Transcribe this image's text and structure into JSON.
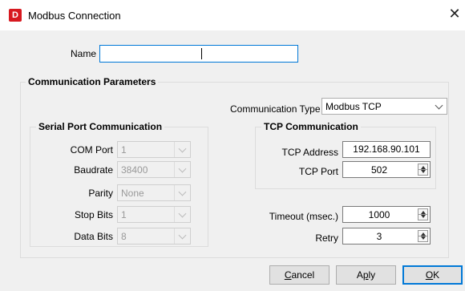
{
  "window": {
    "title": "Modbus Connection",
    "app_icon_letter": "D",
    "close_glyph": "✕"
  },
  "name": {
    "label": "Name",
    "value": ""
  },
  "comm_params": {
    "title": "Communication Parameters"
  },
  "comm_type": {
    "label": "Communication Type",
    "value": "Modbus TCP"
  },
  "serial": {
    "title": "Serial Port Communication",
    "com_port": {
      "label": "COM Port",
      "value": "1"
    },
    "baudrate": {
      "label": "Baudrate",
      "value": "38400"
    },
    "parity": {
      "label": "Parity",
      "value": "None"
    },
    "stop_bits": {
      "label": "Stop Bits",
      "value": "1"
    },
    "data_bits": {
      "label": "Data Bits",
      "value": "8"
    }
  },
  "tcp": {
    "title": "TCP Communication",
    "address": {
      "label": "TCP Address",
      "value": "192.168.90.101"
    },
    "port": {
      "label": "TCP Port",
      "value": "502"
    }
  },
  "timeout": {
    "label": "Timeout (msec.)",
    "value": "1000"
  },
  "retry": {
    "label": "Retry",
    "value": "3"
  },
  "buttons": {
    "cancel_prefix": "C",
    "cancel_rest": "ancel",
    "apply_prefix": "Ap",
    "apply_u": "p",
    "apply_rest": "ly",
    "ok_prefix": "O",
    "ok_rest": "K"
  },
  "colors": {
    "accent": "#0078d7",
    "brand": "#d71920",
    "dialog_bg": "#f0f0f0"
  }
}
